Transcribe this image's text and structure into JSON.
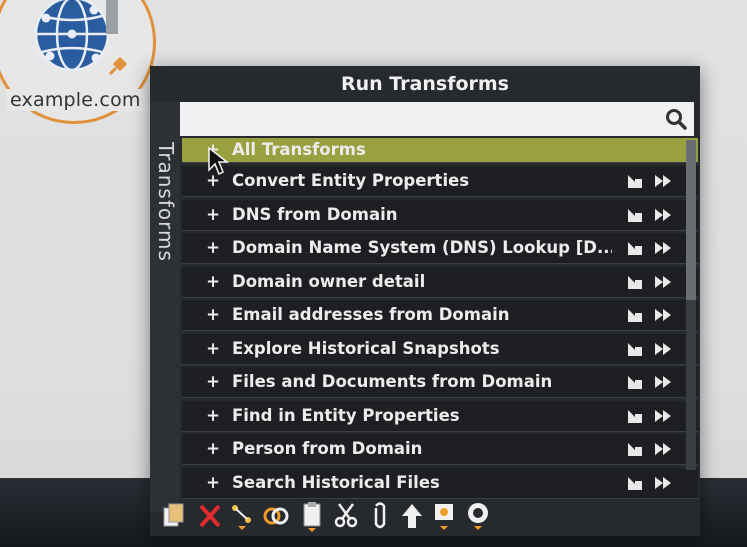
{
  "canvas": {
    "entity_label": "example.com",
    "entity_icon": "globe-network-icon"
  },
  "panel": {
    "title": "Run Transforms",
    "side_tab": "Transforms",
    "search": {
      "value": "",
      "placeholder": "",
      "icon": "search-icon"
    },
    "items": [
      {
        "label": "All Transforms",
        "selected": true,
        "has_actions": false
      },
      {
        "label": "Convert Entity Properties",
        "selected": false,
        "has_actions": true
      },
      {
        "label": "DNS from Domain",
        "selected": false,
        "has_actions": true
      },
      {
        "label": "Domain Name System (DNS) Lookup [D...",
        "selected": false,
        "has_actions": true
      },
      {
        "label": "Domain owner detail",
        "selected": false,
        "has_actions": true
      },
      {
        "label": "Email addresses from Domain",
        "selected": false,
        "has_actions": true
      },
      {
        "label": "Explore Historical Snapshots",
        "selected": false,
        "has_actions": true
      },
      {
        "label": "Files and Documents from Domain",
        "selected": false,
        "has_actions": true
      },
      {
        "label": "Find in Entity Properties",
        "selected": false,
        "has_actions": true
      },
      {
        "label": "Person from Domain",
        "selected": false,
        "has_actions": true
      },
      {
        "label": "Search Historical Files",
        "selected": false,
        "has_actions": true
      }
    ],
    "expand_symbol": "+"
  },
  "toolbar": {
    "buttons": [
      {
        "name": "copy-to-graph-icon"
      },
      {
        "name": "delete-icon"
      },
      {
        "name": "link-dropdown-icon"
      },
      {
        "name": "merge-icon"
      },
      {
        "name": "paste-icon"
      },
      {
        "name": "cut-icon"
      },
      {
        "name": "attach-icon"
      },
      {
        "name": "move-up-icon"
      },
      {
        "name": "bookmark-dropdown-icon"
      },
      {
        "name": "target-dropdown-icon"
      }
    ]
  },
  "colors": {
    "selected_row": "#98a03f",
    "panel_bg": "#26292d",
    "entity_ring": "#e0913a",
    "globe_blue": "#2a6bb0",
    "toolbar_orange": "#f29b2a",
    "delete_red": "#e02b2b"
  }
}
